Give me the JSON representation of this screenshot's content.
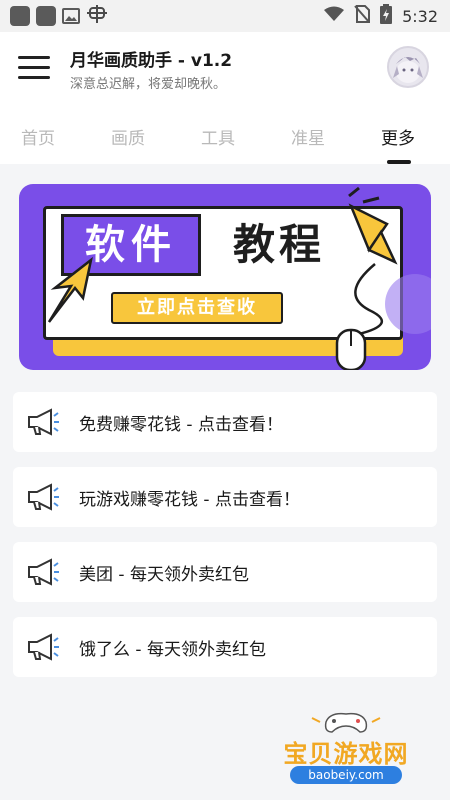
{
  "status_bar": {
    "time": "5:32",
    "icons": [
      "app-square-icon",
      "app-square-icon",
      "image-icon",
      "bug-icon",
      "wifi-icon",
      "no-sim-icon",
      "battery-icon"
    ]
  },
  "header": {
    "title": "月华画质助手 - v1.2",
    "subtitle": "深意总迟解，将爱却晚秋。",
    "menu_icon": "hamburger-menu-icon",
    "avatar_icon": "user-avatar"
  },
  "tabs": [
    {
      "label": "首页",
      "active": false
    },
    {
      "label": "画质",
      "active": false
    },
    {
      "label": "工具",
      "active": false
    },
    {
      "label": "准星",
      "active": false
    },
    {
      "label": "更多",
      "active": true
    }
  ],
  "banner": {
    "word1": "软件",
    "word2": "教程",
    "button": "立即点击查收",
    "colors": {
      "purple": "#7a4ee8",
      "yellow": "#f8c63c"
    }
  },
  "list": [
    {
      "label": "免费赚零花钱 - 点击查看！",
      "icon": "megaphone-icon"
    },
    {
      "label": "玩游戏赚零花钱 - 点击查看！",
      "icon": "megaphone-icon"
    },
    {
      "label": "美团 - 每天领外卖红包",
      "icon": "megaphone-icon"
    },
    {
      "label": "饿了么 - 每天领外卖红包",
      "icon": "megaphone-icon"
    }
  ],
  "watermark": {
    "text": "宝贝游戏网",
    "url": "baobeiy.com"
  }
}
